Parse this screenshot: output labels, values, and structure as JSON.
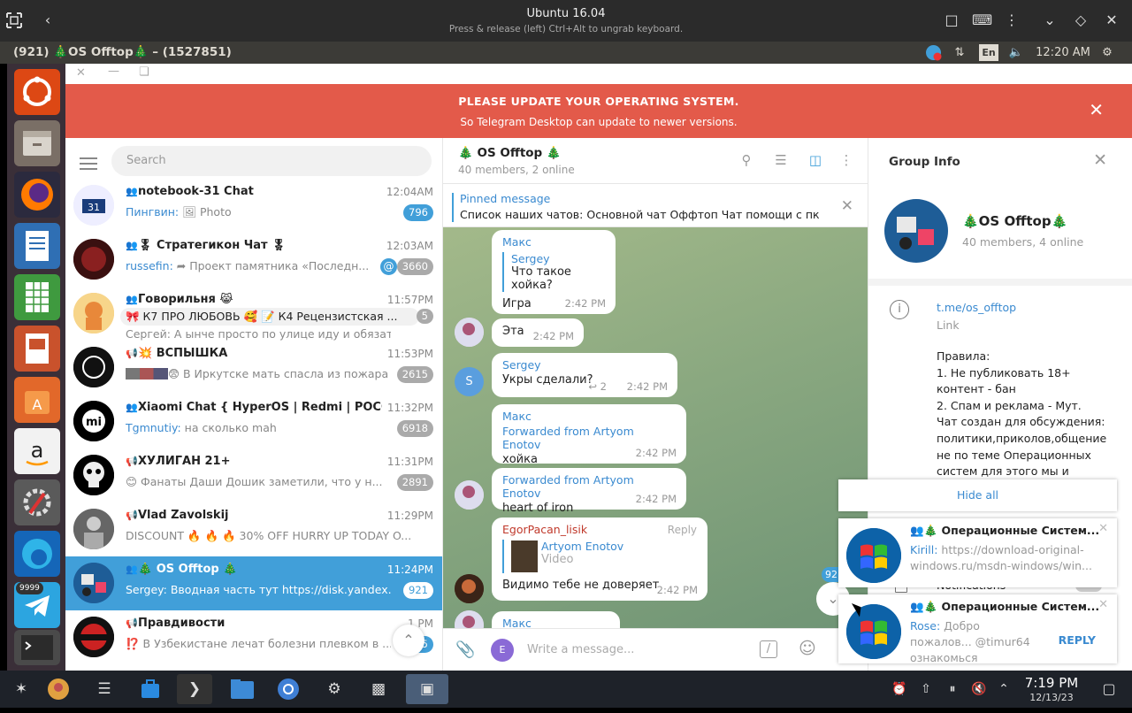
{
  "vm": {
    "title": "Ubuntu 16.04",
    "subtitle": "Press & release (left) Ctrl+Alt to ungrab keyboard."
  },
  "panel": {
    "window_title": "(921) 🎄OS Offtop🎄 – (1527851)",
    "lang": "En",
    "time": "12:20 AM"
  },
  "launcher": {
    "telegram_badge": "9999"
  },
  "banner": {
    "line1": "PLEASE UPDATE YOUR OPERATING SYSTEM.",
    "line2": "So Telegram Desktop can update to newer versions."
  },
  "search": {
    "placeholder": "Search"
  },
  "chats": [
    {
      "name": "notebook-31 Chat",
      "time": "12:04AM",
      "sender": "Пингвин:",
      "preview": " 🖼 Photo",
      "badge": "796"
    },
    {
      "name": "🎖 Стратегикон Чат 🎖",
      "time": "12:03AM",
      "sender": "russefin:",
      "preview": " ➦ Проект памятника «Последн...",
      "badge": "3660",
      "mention": "@"
    },
    {
      "name": "Говорильня 😹",
      "time": "11:57PM",
      "sender": "🎀 К7 ПРО ЛЮБОВЬ 🥰  📝 К4 Рецензистская ...",
      "preview": "Сергей: А ынче просто по улице иду и обязател...",
      "badge": "5"
    },
    {
      "name": "💥 ВСПЫШКА",
      "time": "11:53PM",
      "sender": "",
      "preview": "😨 В Иркутске мать спасла из пожара ...",
      "badge": "2615"
    },
    {
      "name": "Xiaomi Chat { HyperOS | Redmi | POCO }",
      "time": "11:32PM",
      "sender": "Tgmnutiy:",
      "preview": " на сколько mah",
      "badge": "6918"
    },
    {
      "name": "ХУЛИГАН 21+",
      "time": "11:31PM",
      "sender": "",
      "preview": "😊 Фанаты Даши Дошик   заметили, что у н...",
      "badge": "2891"
    },
    {
      "name": "Vlad Zavolskij",
      "time": "11:29PM",
      "sender": "",
      "preview": "DISCOUNT 🔥 🔥 🔥 30% OFF HURRY UP TODAY O...",
      "badge": ""
    },
    {
      "name": "🎄 OS Offtop 🎄",
      "time": "11:24PM",
      "sender": "",
      "preview": "Sergey: Вводная часть тут https://disk.yandex.ru/...",
      "badge": "921"
    },
    {
      "name": "Правдивости",
      "time": "1  PM",
      "sender": "",
      "preview": "⁉️ В Узбекистане лечат болезни плевком в ...",
      "badge": "375"
    }
  ],
  "header": {
    "title": "🎄 OS Offtop 🎄",
    "subtitle": "40 members, 2 online"
  },
  "pinned": {
    "title": "Pinned message",
    "text": "Список наших чатов: Основной чат Оффтоп  Чат помощи с пк"
  },
  "messages": [
    {
      "name": "Макс",
      "reply_name": "Sergey",
      "reply_text": "Что такое хойка?",
      "text": "Игра",
      "time": "2:42 PM"
    },
    {
      "text": "Эта",
      "time": "2:42 PM"
    },
    {
      "name": "Sergey",
      "text": "Укры сделали?",
      "time": "2:42 PM",
      "replies": "↩ 2"
    },
    {
      "name": "Макс",
      "fwd": "Forwarded from Artyom Enotov",
      "text": "хойка",
      "time": "2:42 PM"
    },
    {
      "fwd": "Forwarded from Artyom Enotov",
      "text": "heart of iron",
      "time": "2:42 PM"
    },
    {
      "name": "EgorPacan_lisik",
      "reply_label": "Reply",
      "reply_name": "Artyom Enotov",
      "reply_text": "Video",
      "text": "Видимо тебе не доверяет",
      "time": "2:42 PM"
    },
    {
      "name": "Макс"
    }
  ],
  "scroll_badge": "921",
  "composer": {
    "placeholder": "Write a message...",
    "avatar_letter": "E"
  },
  "group_info": {
    "title": "Group Info",
    "name": "🎄OS Offtop🎄",
    "members": "40 members, 4 online",
    "link": "t.me/os_offtop",
    "link_label": "Link",
    "rules": "Правила:\n1. Не публиковать 18+\nконтент - бан\n2. Спам и реклама - Мут.\nЧат создан для обсуждения:\nполитики,приколов,общение\nне по теме Операционных\nсистем для этого мы и",
    "notifications_label": "Notifications"
  },
  "notifications": {
    "hide_all": "Hide all",
    "items": [
      {
        "title": "🎄 Операционные Систем...",
        "sender": "Kirill:",
        "text": " https://download-original-windows.ru/msdn-windows/win..."
      },
      {
        "title": "🎄 Операционные Систем...",
        "sender": "Rose:",
        "text": " Добро пожалов... @timur64 ознакомься",
        "reply": "REPLY"
      }
    ]
  },
  "taskbar": {
    "time": "7:19 PM",
    "date": "12/13/23"
  },
  "colors": {
    "accent": "#419fd9",
    "banner": "#e35a4a",
    "panel": "#3c3b37",
    "launcher": "#3a2f38"
  }
}
